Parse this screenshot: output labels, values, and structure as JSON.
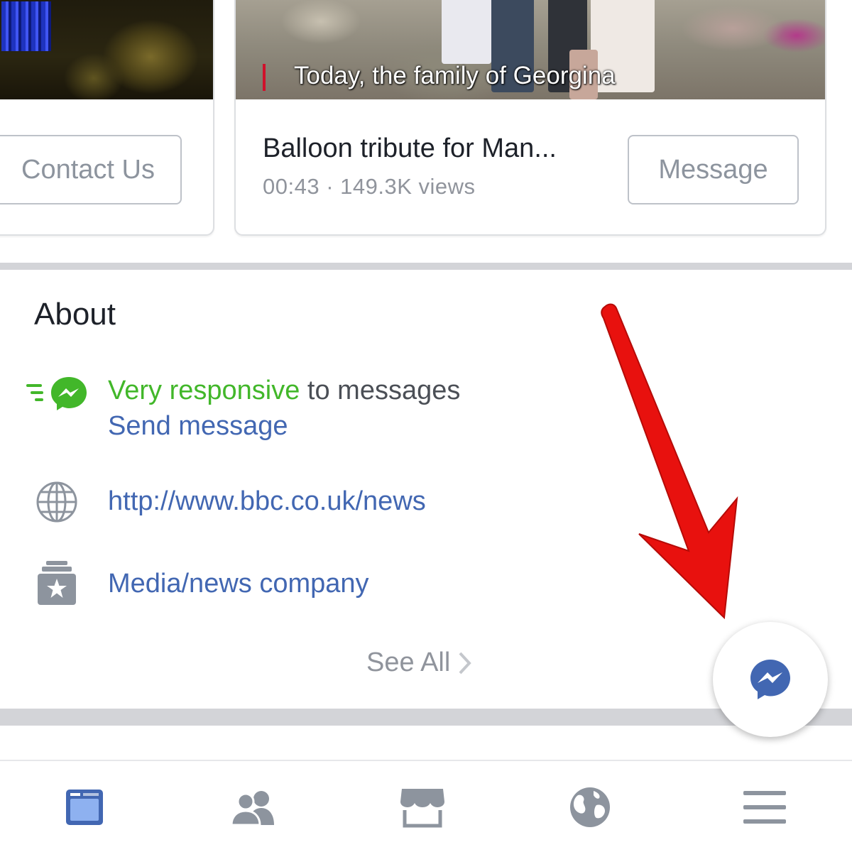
{
  "cards": {
    "left": {
      "button_label": "Contact Us"
    },
    "right": {
      "thumbnail_caption": "Today, the family of Georgina",
      "title": "Balloon tribute for Man...",
      "meta": "00:43 · 149.3K views",
      "button_label": "Message"
    }
  },
  "about": {
    "title": "About",
    "responsiveness": {
      "highlight": "Very responsive",
      "rest": " to messages",
      "action_label": "Send message",
      "icon": "messenger-responsive-icon"
    },
    "website": {
      "url": "http://www.bbc.co.uk/news",
      "icon": "globe-icon"
    },
    "category": {
      "label": "Media/news company",
      "icon": "page-category-icon"
    },
    "see_all_label": "See All"
  },
  "tabbar": {
    "items": [
      {
        "icon": "news-feed-icon",
        "active": true
      },
      {
        "icon": "friends-icon",
        "active": false
      },
      {
        "icon": "marketplace-icon",
        "active": false
      },
      {
        "icon": "notifications-globe-icon",
        "active": false
      },
      {
        "icon": "menu-icon",
        "active": false
      }
    ]
  },
  "colors": {
    "facebook_blue": "#4267b2",
    "responsive_green": "#42b72a",
    "arrow_red": "#e8110e",
    "secondary_text": "#90949c"
  }
}
